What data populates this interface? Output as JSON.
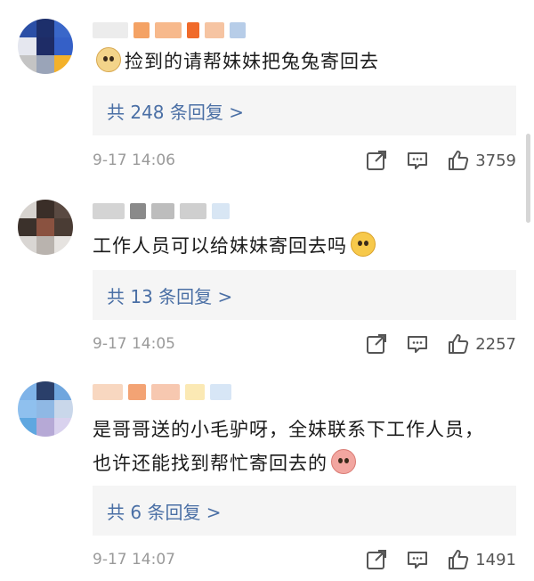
{
  "comments": [
    {
      "text": "捡到的请帮妹妹把兔兔寄回去",
      "emoji": "dog-face-emoji",
      "reply_link": "共 248 条回复 >",
      "time": "9-17 14:06",
      "likes": "3759",
      "avatar_colors": [
        "#2b4fa6",
        "#1d2f6b",
        "#3a67c9",
        "#e5e7ef",
        "#1e2c66",
        "#3560c7",
        "#c4c4c4",
        "#9aa4b8",
        "#f3b12a"
      ],
      "name_colors": [
        "#ececec",
        "#f4a264",
        "#f7b98c",
        "#f06a2a",
        "#f6c4a2",
        "#b7cde8"
      ]
    },
    {
      "text": "工作人员可以给妹妹寄回去吗",
      "emoji": "pleading-face-emoji",
      "reply_link": "共 13 条回复 >",
      "time": "9-17 14:05",
      "likes": "2257",
      "avatar_colors": [
        "#d7d3cf",
        "#3a2e28",
        "#5a4a42",
        "#3b312b",
        "#8a5240",
        "#4a3c34",
        "#d9d6d3",
        "#b9b3ae",
        "#e6e3e0"
      ],
      "name_colors": [
        "#d4d4d4",
        "#8a8a8a",
        "#bdbdbd",
        "#cfcfcf",
        "#d8e6f4"
      ]
    },
    {
      "text": "是哥哥送的小毛驴呀，全妹联系下工作人员，也许还能找到帮忙寄回去的",
      "emoji": "pig-face-emoji",
      "reply_link": "共 6 条回复 >",
      "time": "9-17 14:07",
      "likes": "1491",
      "avatar_colors": [
        "#7fb3e8",
        "#2a3f6a",
        "#6fa6de",
        "#8fc0ee",
        "#8fb8e4",
        "#c9d7ea",
        "#5fa7e0",
        "#b6a9d6",
        "#d9d2ee"
      ],
      "name_colors": [
        "#f8d7c0",
        "#f3a374",
        "#f7c8b0",
        "#fbe9b4",
        "#d7e6f6"
      ]
    }
  ],
  "icons": {
    "share": "share-icon",
    "comment": "comment-icon",
    "like": "thumbs-up-icon"
  }
}
